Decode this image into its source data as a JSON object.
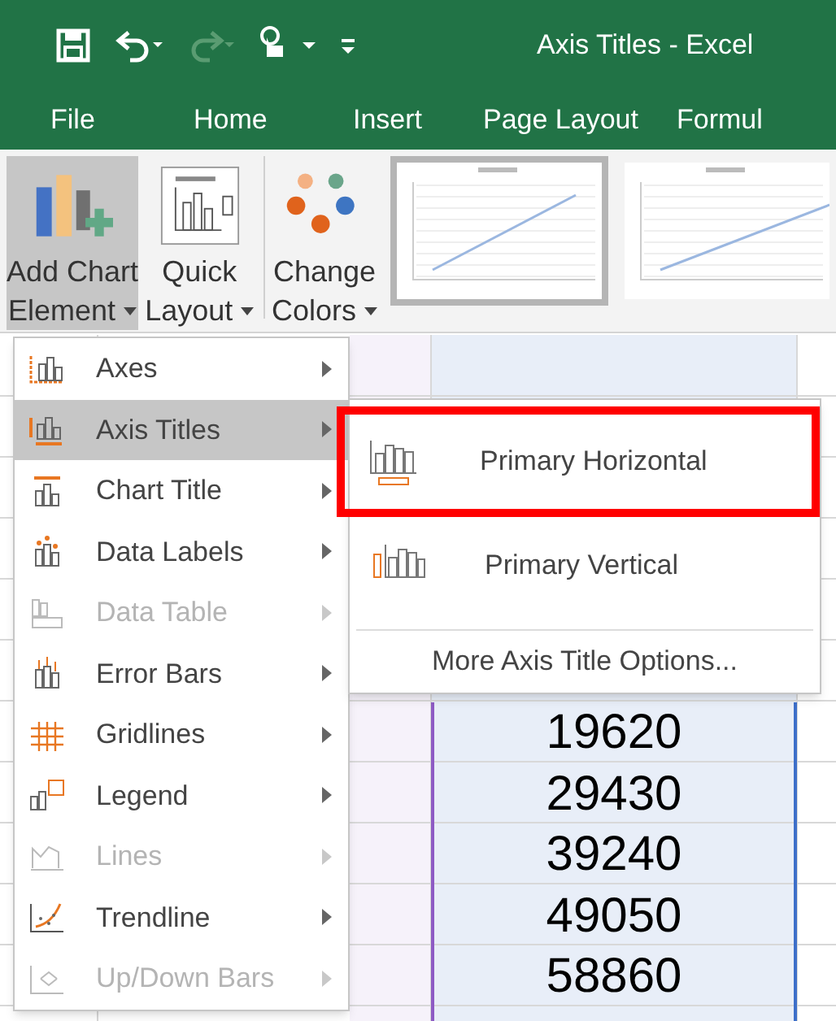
{
  "window": {
    "title": "Axis Titles - Excel"
  },
  "ribbon_tabs": [
    {
      "label": "File",
      "selected": false
    },
    {
      "label": "Home",
      "selected": false
    },
    {
      "label": "Insert",
      "selected": false
    },
    {
      "label": "Page Layout",
      "selected": false
    },
    {
      "label": "Formul",
      "selected": false
    }
  ],
  "ribbon": {
    "buttons": [
      {
        "line_1": "Add Chart",
        "line_2": "Element",
        "selected": true
      },
      {
        "line_1": "Quick",
        "line_2": "Layout",
        "selected": false
      },
      {
        "line_1": "Change",
        "line_2": "Colors",
        "selected": false
      }
    ],
    "chart_styles": [
      {
        "selected": true
      },
      {
        "selected": false
      }
    ]
  },
  "menu": {
    "items": [
      {
        "label": "Axes",
        "selected": false,
        "disabled": false
      },
      {
        "label": "Axis Titles",
        "selected": true,
        "disabled": false
      },
      {
        "label": "Chart Title",
        "selected": false,
        "disabled": false
      },
      {
        "label": "Data Labels",
        "selected": false,
        "disabled": false
      },
      {
        "label": "Data Table",
        "selected": false,
        "disabled": true
      },
      {
        "label": "Error Bars",
        "selected": false,
        "disabled": false
      },
      {
        "label": "Gridlines",
        "selected": false,
        "disabled": false
      },
      {
        "label": "Legend",
        "selected": false,
        "disabled": false
      },
      {
        "label": "Lines",
        "selected": false,
        "disabled": true
      },
      {
        "label": "Trendline",
        "selected": false,
        "disabled": false
      },
      {
        "label": "Up/Down Bars",
        "selected": false,
        "disabled": true
      }
    ]
  },
  "submenu": {
    "items": [
      {
        "label": "Primary Horizontal",
        "highlighted": true
      },
      {
        "label": "Primary Vertical",
        "highlighted": false
      }
    ],
    "more": "More Axis Title Options..."
  },
  "cells": [
    "19620",
    "29430",
    "39240",
    "49050",
    "58860"
  ]
}
